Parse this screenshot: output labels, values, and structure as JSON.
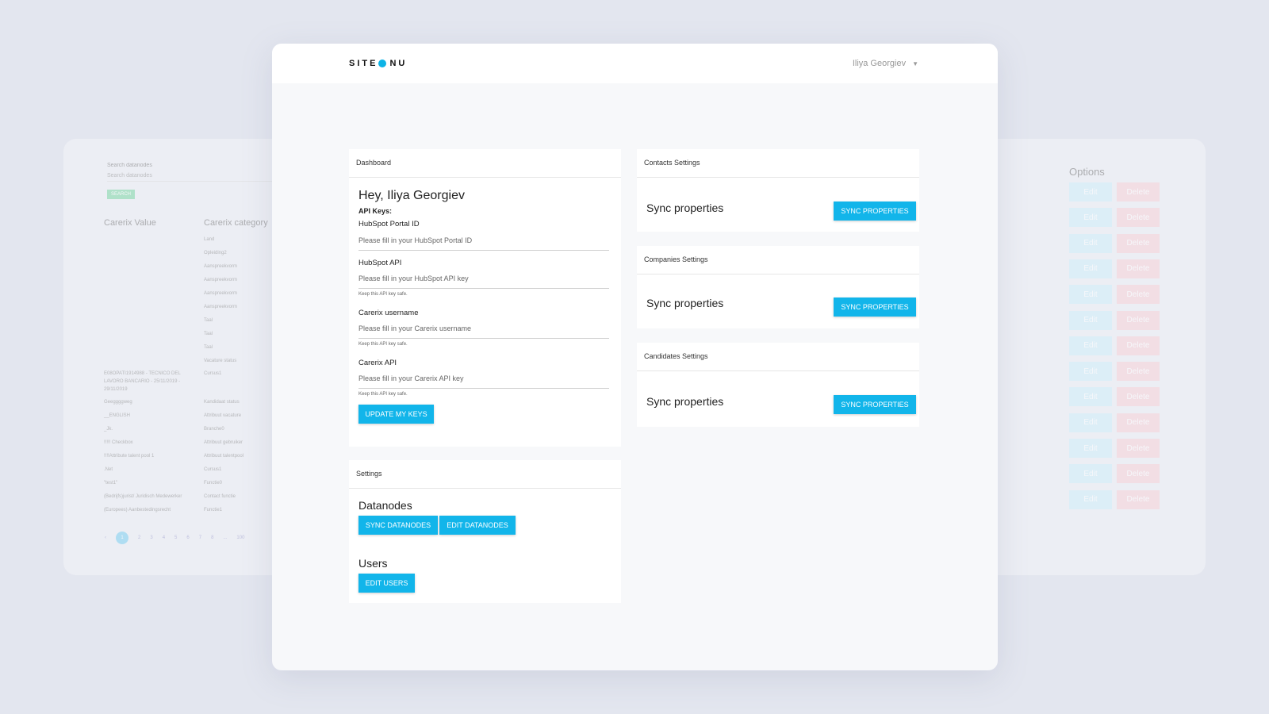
{
  "background": {
    "search_label": "Search datanodes",
    "search_placeholder": "Search datanodes",
    "search_button": "SEARCH",
    "col1_header": "Carerix Value",
    "col2_header": "Carerix category",
    "rows": [
      {
        "value": "",
        "category": "Land"
      },
      {
        "value": "",
        "category": "Opleiding2"
      },
      {
        "value": "",
        "category": "Aanspreekvorm"
      },
      {
        "value": "",
        "category": "Aanspreekvorm"
      },
      {
        "value": "",
        "category": "Aanspreekvorm"
      },
      {
        "value": "",
        "category": "Aanspreekvorm"
      },
      {
        "value": "",
        "category": "Taal"
      },
      {
        "value": "",
        "category": "Taal"
      },
      {
        "value": "",
        "category": "Taal"
      },
      {
        "value": "",
        "category": "Vacature status"
      },
      {
        "value": "E08OPATI1914988 - TECNICO DEL LAVORO BANCARIO - 25/11/2019 - 29/11/2019",
        "category": "Cursus1"
      },
      {
        "value": "Geeggggweg",
        "category": "Kandidaat status"
      },
      {
        "value": "__ENGLISH",
        "category": "Attribuut vacature"
      },
      {
        "value": "_Jk.",
        "category": "Branche0"
      },
      {
        "value": "!!!!! Checkbox",
        "category": "Attribuut gebruiker"
      },
      {
        "value": "!!!!Attribute talent pool 1",
        "category": "Attribuut talentpool"
      },
      {
        "value": ".Net",
        "category": "Cursus1"
      },
      {
        "value": "\"test1\"",
        "category": "Functie0"
      },
      {
        "value": "(Bedrijfs)jurist/ Juridisch Medewerker",
        "category": "Contact functie"
      },
      {
        "value": "(Europees) Aanbestedingsrecht",
        "category": "Functie1"
      }
    ],
    "pager": [
      "‹",
      "1",
      "2",
      "3",
      "4",
      "5",
      "6",
      "7",
      "8",
      "...",
      "100"
    ],
    "options_label": "Options",
    "edit_label": "Edit",
    "delete_label": "Delete"
  },
  "header": {
    "logo_left": "SITE",
    "logo_right": "NU",
    "user_name": "Iliya Georgiev",
    "caret": "▼"
  },
  "dashboard": {
    "header": "Dashboard",
    "greeting": "Hey, Iliya Georgiev",
    "api_keys_title": "API Keys:",
    "fields": [
      {
        "label": "HubSpot Portal ID",
        "placeholder": "Please fill in your HubSpot Portal ID",
        "hint": ""
      },
      {
        "label": "HubSpot API",
        "placeholder": "Please fill in your HubSpot API key",
        "hint": "Keep this API key safe."
      },
      {
        "label": "Carerix username",
        "placeholder": "Please fill in your Carerix username",
        "hint": "Keep this API key safe."
      },
      {
        "label": "Carerix API",
        "placeholder": "Please fill in your Carerix API key",
        "hint": "Keep this API key safe."
      }
    ],
    "update_button": "UPDATE MY KEYS"
  },
  "settings": {
    "header": "Settings",
    "datanodes_title": "Datanodes",
    "sync_datanodes": "SYNC DATANODES",
    "edit_datanodes": "EDIT DATANODES",
    "users_title": "Users",
    "edit_users": "EDIT USERS"
  },
  "sync_cards": [
    {
      "header": "Contacts Settings",
      "label": "Sync properties",
      "button": "SYNC PROPERTIES"
    },
    {
      "header": "Companies Settings",
      "label": "Sync properties",
      "button": "SYNC PROPERTIES"
    },
    {
      "header": "Candidates Settings",
      "label": "Sync properties",
      "button": "SYNC PROPERTIES"
    }
  ]
}
